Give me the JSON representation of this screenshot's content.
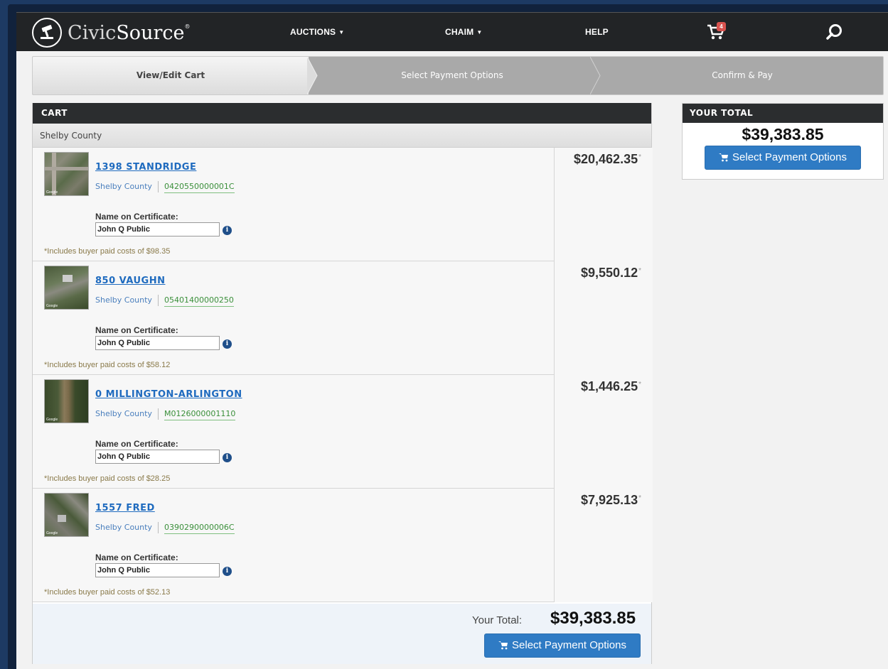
{
  "app": {
    "logo_text_civic": "Civic",
    "logo_text_source": "Source",
    "logo_reg": "®"
  },
  "nav": {
    "auctions": "AUCTIONS",
    "user": "CHAIM",
    "help": "HELP",
    "cart_count": "4"
  },
  "steps": [
    {
      "label": "View/Edit Cart",
      "active": true
    },
    {
      "label": "Select Payment Options",
      "active": false
    },
    {
      "label": "Confirm & Pay",
      "active": false
    }
  ],
  "cart": {
    "heading": "CART",
    "county": "Shelby County",
    "items": [
      {
        "address": "1398 STANDRIDGE",
        "county": "Shelby County",
        "parcel": "0420550000001C",
        "cert_label": "Name on Certificate:",
        "cert_name": "John Q Public",
        "costs": "*Includes buyer paid costs of $98.35",
        "price": "$20,462.35",
        "asterisk": "*"
      },
      {
        "address": "850 VAUGHN",
        "county": "Shelby County",
        "parcel": "05401400000250",
        "cert_label": "Name on Certificate:",
        "cert_name": "John Q Public",
        "costs": "*Includes buyer paid costs of $58.12",
        "price": "$9,550.12",
        "asterisk": "*"
      },
      {
        "address": "0 MILLINGTON-ARLINGTON",
        "county": "Shelby County",
        "parcel": "M0126000001110",
        "cert_label": "Name on Certificate:",
        "cert_name": "John Q Public",
        "costs": "*Includes buyer paid costs of $28.25",
        "price": "$1,446.25",
        "asterisk": "*"
      },
      {
        "address": "1557 FRED",
        "county": "Shelby County",
        "parcel": "0390290000006C",
        "cert_label": "Name on Certificate:",
        "cert_name": "John Q Public",
        "costs": "*Includes buyer paid costs of $52.13",
        "price": "$7,925.13",
        "asterisk": "*"
      }
    ],
    "thumb_label": "Google",
    "total_label": "Your Total:",
    "total_value": "$39,383.85",
    "button_label": "Select Payment Options"
  },
  "summary": {
    "heading": "YOUR TOTAL",
    "amount": "$39,383.85",
    "button_label": "Select Payment Options"
  },
  "colors": {
    "accent": "#2f7bc4",
    "header": "#222426",
    "link": "#1f6bbf",
    "parcel": "#3a8f3a"
  }
}
